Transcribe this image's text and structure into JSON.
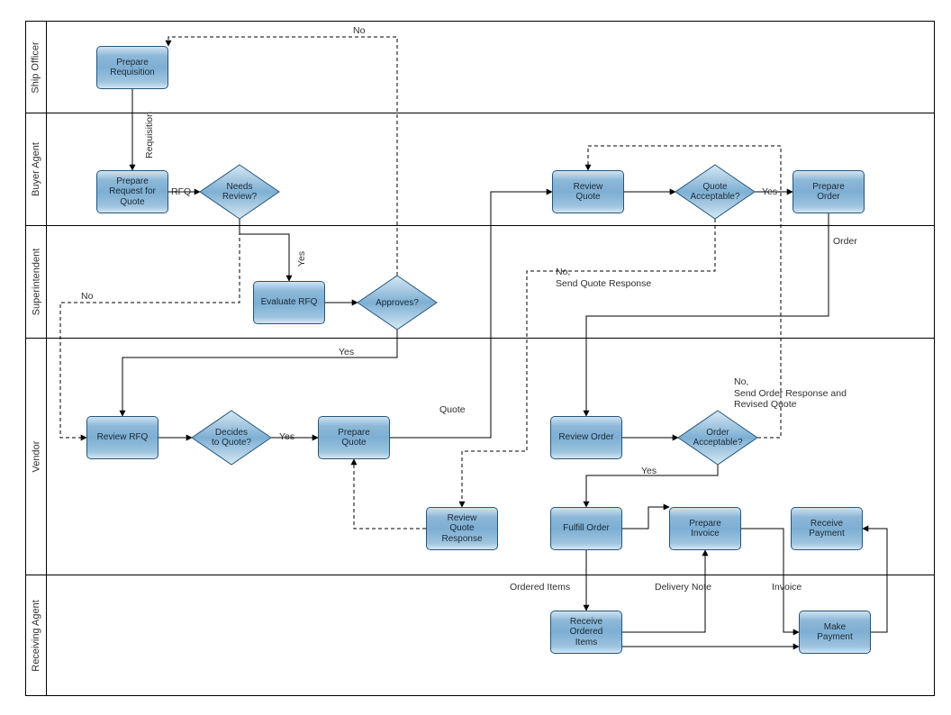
{
  "lanes": {
    "l0": "Ship Officer",
    "l1": "Buyer Agent",
    "l2": "Superintendent",
    "l3": "Vendor",
    "l4": "Receiving Agent"
  },
  "procs": {
    "prepare_requisition": "Prepare\nRequisition",
    "prepare_rfq": "Prepare\nRequest for\nQuote",
    "review_quote": "Review\nQuote",
    "prepare_order": "Prepare\nOrder",
    "evaluate_rfq": "Evaluate RFQ",
    "review_rfq": "Review RFQ",
    "prepare_quote": "Prepare\nQuote",
    "review_order": "Review Order",
    "review_quote_response": "Review\nQuote\nResponse",
    "fulfill_order": "Fulfill Order",
    "prepare_invoice": "Prepare\nInvoice",
    "receive_payment": "Receive\nPayment",
    "receive_ordered_items": "Receive\nOrdered\nItems",
    "make_payment": "Make\nPayment"
  },
  "decisions": {
    "needs_review": "Needs\nReview?",
    "approves": "Approves?",
    "quote_acceptable": "Quote\nAcceptable?",
    "decides_to_quote": "Decides\nto Quote?",
    "order_acceptable": "Order\nAcceptable?"
  },
  "labels": {
    "no_top": "No",
    "requisition": "Requisition",
    "rfq": "RFQ",
    "yes_needs": "Yes",
    "approves_no": "No",
    "approves_yes": "Yes",
    "quote": "Quote",
    "dtq_yes": "Yes",
    "qa_yes": "Yes",
    "qa_no": "No,\nSend Quote Response",
    "order_lbl": "Order",
    "oa_yes": "Yes",
    "oa_no": "No,\nSend Order Response and\nRevised Quote",
    "ordered_items": "Ordered Items",
    "delivery_note": "Delivery Note",
    "invoice": "Invoice"
  }
}
